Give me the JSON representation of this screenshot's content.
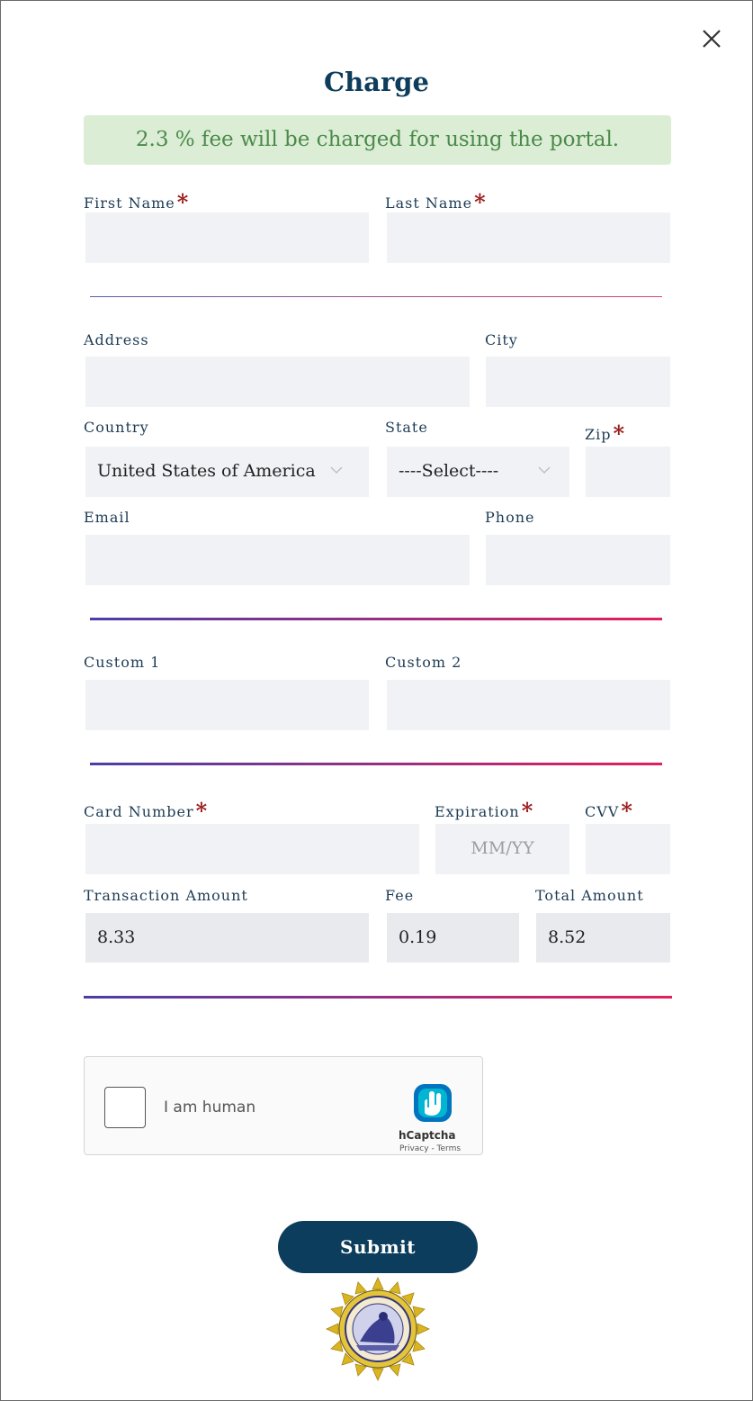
{
  "dialog": {
    "title": "Charge",
    "close_icon": "close-icon"
  },
  "notice": {
    "text": "2.3 % fee will be charged for using the portal.",
    "bg_color": "#dbedd4",
    "text_color": "#4b8a4b"
  },
  "labels": {
    "first_name": "First Name",
    "last_name": "Last Name",
    "address": "Address",
    "city": "City",
    "country": "Country",
    "state": "State",
    "zip": "Zip",
    "email": "Email",
    "phone": "Phone",
    "custom1": "Custom 1",
    "custom2": "Custom 2",
    "card_number": "Card Number",
    "expiration": "Expiration",
    "cvv": "CVV",
    "transaction_amount": "Transaction Amount",
    "fee": "Fee",
    "total_amount": "Total Amount"
  },
  "required_marker": "*",
  "fields": {
    "country_selected": "United States of America",
    "state_selected": "----Select----",
    "expiration_placeholder": "MM/YY",
    "transaction_amount": "8.33",
    "fee": "0.19",
    "total_amount": "8.52"
  },
  "captcha": {
    "label": "I am human",
    "brand": "hCaptcha",
    "links": "Privacy - Terms",
    "checked": false
  },
  "submit_label": "Submit",
  "colors": {
    "primary": "#0c3d5c",
    "required": "#9b1b1b",
    "field_bg": "#f1f2f6",
    "rule_start": "#4b3ea8",
    "rule_end": "#e41f5c"
  },
  "icons": {
    "chevron": "chevron-down-icon",
    "captcha_logo": "hcaptcha-logo-icon",
    "seal": "state-seal-logo"
  }
}
